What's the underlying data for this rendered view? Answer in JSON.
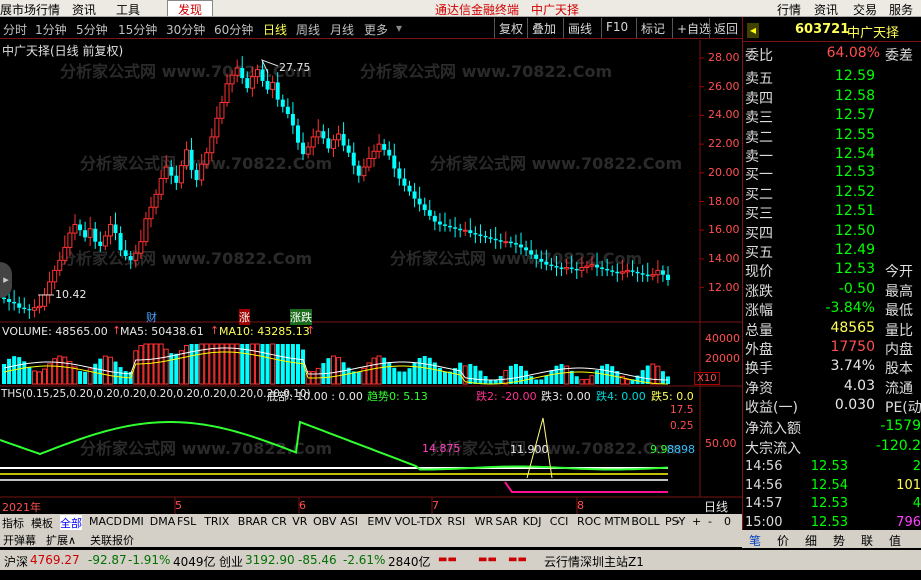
{
  "menubar": {
    "items": [
      "展市场行情",
      "资讯",
      "工具",
      "发现",
      "通达信金融终端",
      "中广天择",
      "行情",
      "资讯",
      "交易",
      "服务"
    ]
  },
  "periods": [
    "分时",
    "1分钟",
    "5分钟",
    "15分钟",
    "30分钟",
    "60分钟",
    "日线",
    "周线",
    "月线",
    "更多"
  ],
  "active_period": "日线",
  "toolbar": [
    "复权",
    "叠加",
    "画线",
    "F10",
    "标记",
    "+自选",
    "返回"
  ],
  "stock_title": "中广天择(日线 前复权)",
  "watermark": "分析家公式网 www.70822.Com",
  "price_axis": [
    "28.00",
    "26.00",
    "24.00",
    "22.00",
    "20.00",
    "18.00",
    "16.00",
    "14.00",
    "12.00"
  ],
  "annotations": {
    "high": "27.75",
    "low": "10.42",
    "fin": "财",
    "up": "涨",
    "down_up": "涨跌"
  },
  "volume_header": {
    "vol": "VOLUME: 48565.00",
    "ma5": "MA5: 50438.61",
    "ma10": "MA10: 43285.13"
  },
  "volume_axis": [
    "40000",
    "20000",
    "X10"
  ],
  "ind_header": {
    "name": "THS(0.15,25,0.20,0.20,0.20,0.20,0.20,0.20,0.20,0.20,0.10)",
    "bottom": "底部: 10.00 : 0.00",
    "trend": "趋势0: 5.13",
    "d2": "跌2: -20.00",
    "d3": "跌3: 0.00",
    "d4": "跌4: 0.00",
    "d5": "跌5: 0.0"
  },
  "ind_axis": [
    "17.5",
    "0.25",
    "50.00"
  ],
  "ind_labels": {
    "a": "14.875",
    "b": "11.900",
    "c": "9.9",
    "d": "8898"
  },
  "date_axis": {
    "y": "2021年",
    "m5": "5",
    "m6": "6",
    "m7": "7",
    "m8": "8",
    "period": "日线"
  },
  "tabs": [
    "指标",
    "模板",
    "全部",
    "MACD",
    "DMI",
    "DMA",
    "FSL",
    "TRIX",
    "BRAR",
    "CR",
    "VR",
    "OBV",
    "ASI",
    "EMV",
    "VOL-TDX",
    "RSI",
    "WR",
    "SAR",
    "KDJ",
    "CCI",
    "ROC",
    "MTM",
    "BOLL",
    "PSY"
  ],
  "bottom": [
    "开弹幕",
    "扩展∧",
    "关联报价"
  ],
  "quote": {
    "code": "603721",
    "name": "中广天择",
    "weibi_label": "委比",
    "weibi": "64.08%",
    "weicha": "委差",
    "asks": [
      {
        "k": "卖五",
        "p": "12.59"
      },
      {
        "k": "卖四",
        "p": "12.58"
      },
      {
        "k": "卖三",
        "p": "12.57"
      },
      {
        "k": "卖二",
        "p": "12.55"
      },
      {
        "k": "卖一",
        "p": "12.54"
      }
    ],
    "bids": [
      {
        "k": "买一",
        "p": "12.53"
      },
      {
        "k": "买二",
        "p": "12.52"
      },
      {
        "k": "买三",
        "p": "12.51"
      },
      {
        "k": "买四",
        "p": "12.50"
      },
      {
        "k": "买五",
        "p": "12.49"
      }
    ],
    "rows": [
      {
        "k": "现价",
        "v": "12.53",
        "k2": "今开"
      },
      {
        "k": "涨跌",
        "v": "-0.50",
        "k2": "最高"
      },
      {
        "k": "涨幅",
        "v": "-3.84%",
        "k2": "最低"
      },
      {
        "k": "总量",
        "v": "48565",
        "k2": "量比"
      },
      {
        "k": "外盘",
        "v": "17750",
        "k2": "内盘"
      }
    ],
    "rows2": [
      {
        "k": "换手",
        "v": "3.74%",
        "k2": "股本"
      },
      {
        "k": "净资",
        "v": "4.03",
        "k2": "流通"
      },
      {
        "k": "收益(一)",
        "v": "0.030",
        "k2": "PE(动)"
      }
    ],
    "flow": [
      {
        "k": "净流入额",
        "v": "-1579"
      },
      {
        "k": "大宗流入",
        "v": "-120.2"
      }
    ],
    "ticks": [
      {
        "t": "14:56",
        "p": "12.53",
        "v": "2"
      },
      {
        "t": "14:56",
        "p": "12.54",
        "v": "101"
      },
      {
        "t": "14:57",
        "p": "12.53",
        "v": "4"
      },
      {
        "t": "15:00",
        "p": "12.53",
        "v": "796"
      }
    ]
  },
  "rtabs": [
    "笔",
    "价",
    "细",
    "势",
    "联",
    "值"
  ],
  "status": {
    "sh": "沪深",
    "sh_v": "4769.27",
    "sh_c": "-92.87",
    "sh_p": "-1.91%",
    "sh_amt": "4049亿",
    "cy": "创业",
    "cy_v": "3192.90",
    "cy_c": "-85.46",
    "cy_p": "-2.61%",
    "cy_amt": "2840亿",
    "server": "云行情深圳主站Z1"
  },
  "chart_data": {
    "type": "candlestick",
    "series": [
      {
        "name": "MA5",
        "values": []
      },
      {
        "name": "MA10",
        "values": []
      }
    ],
    "high": 27.75,
    "low": 10.42
  }
}
